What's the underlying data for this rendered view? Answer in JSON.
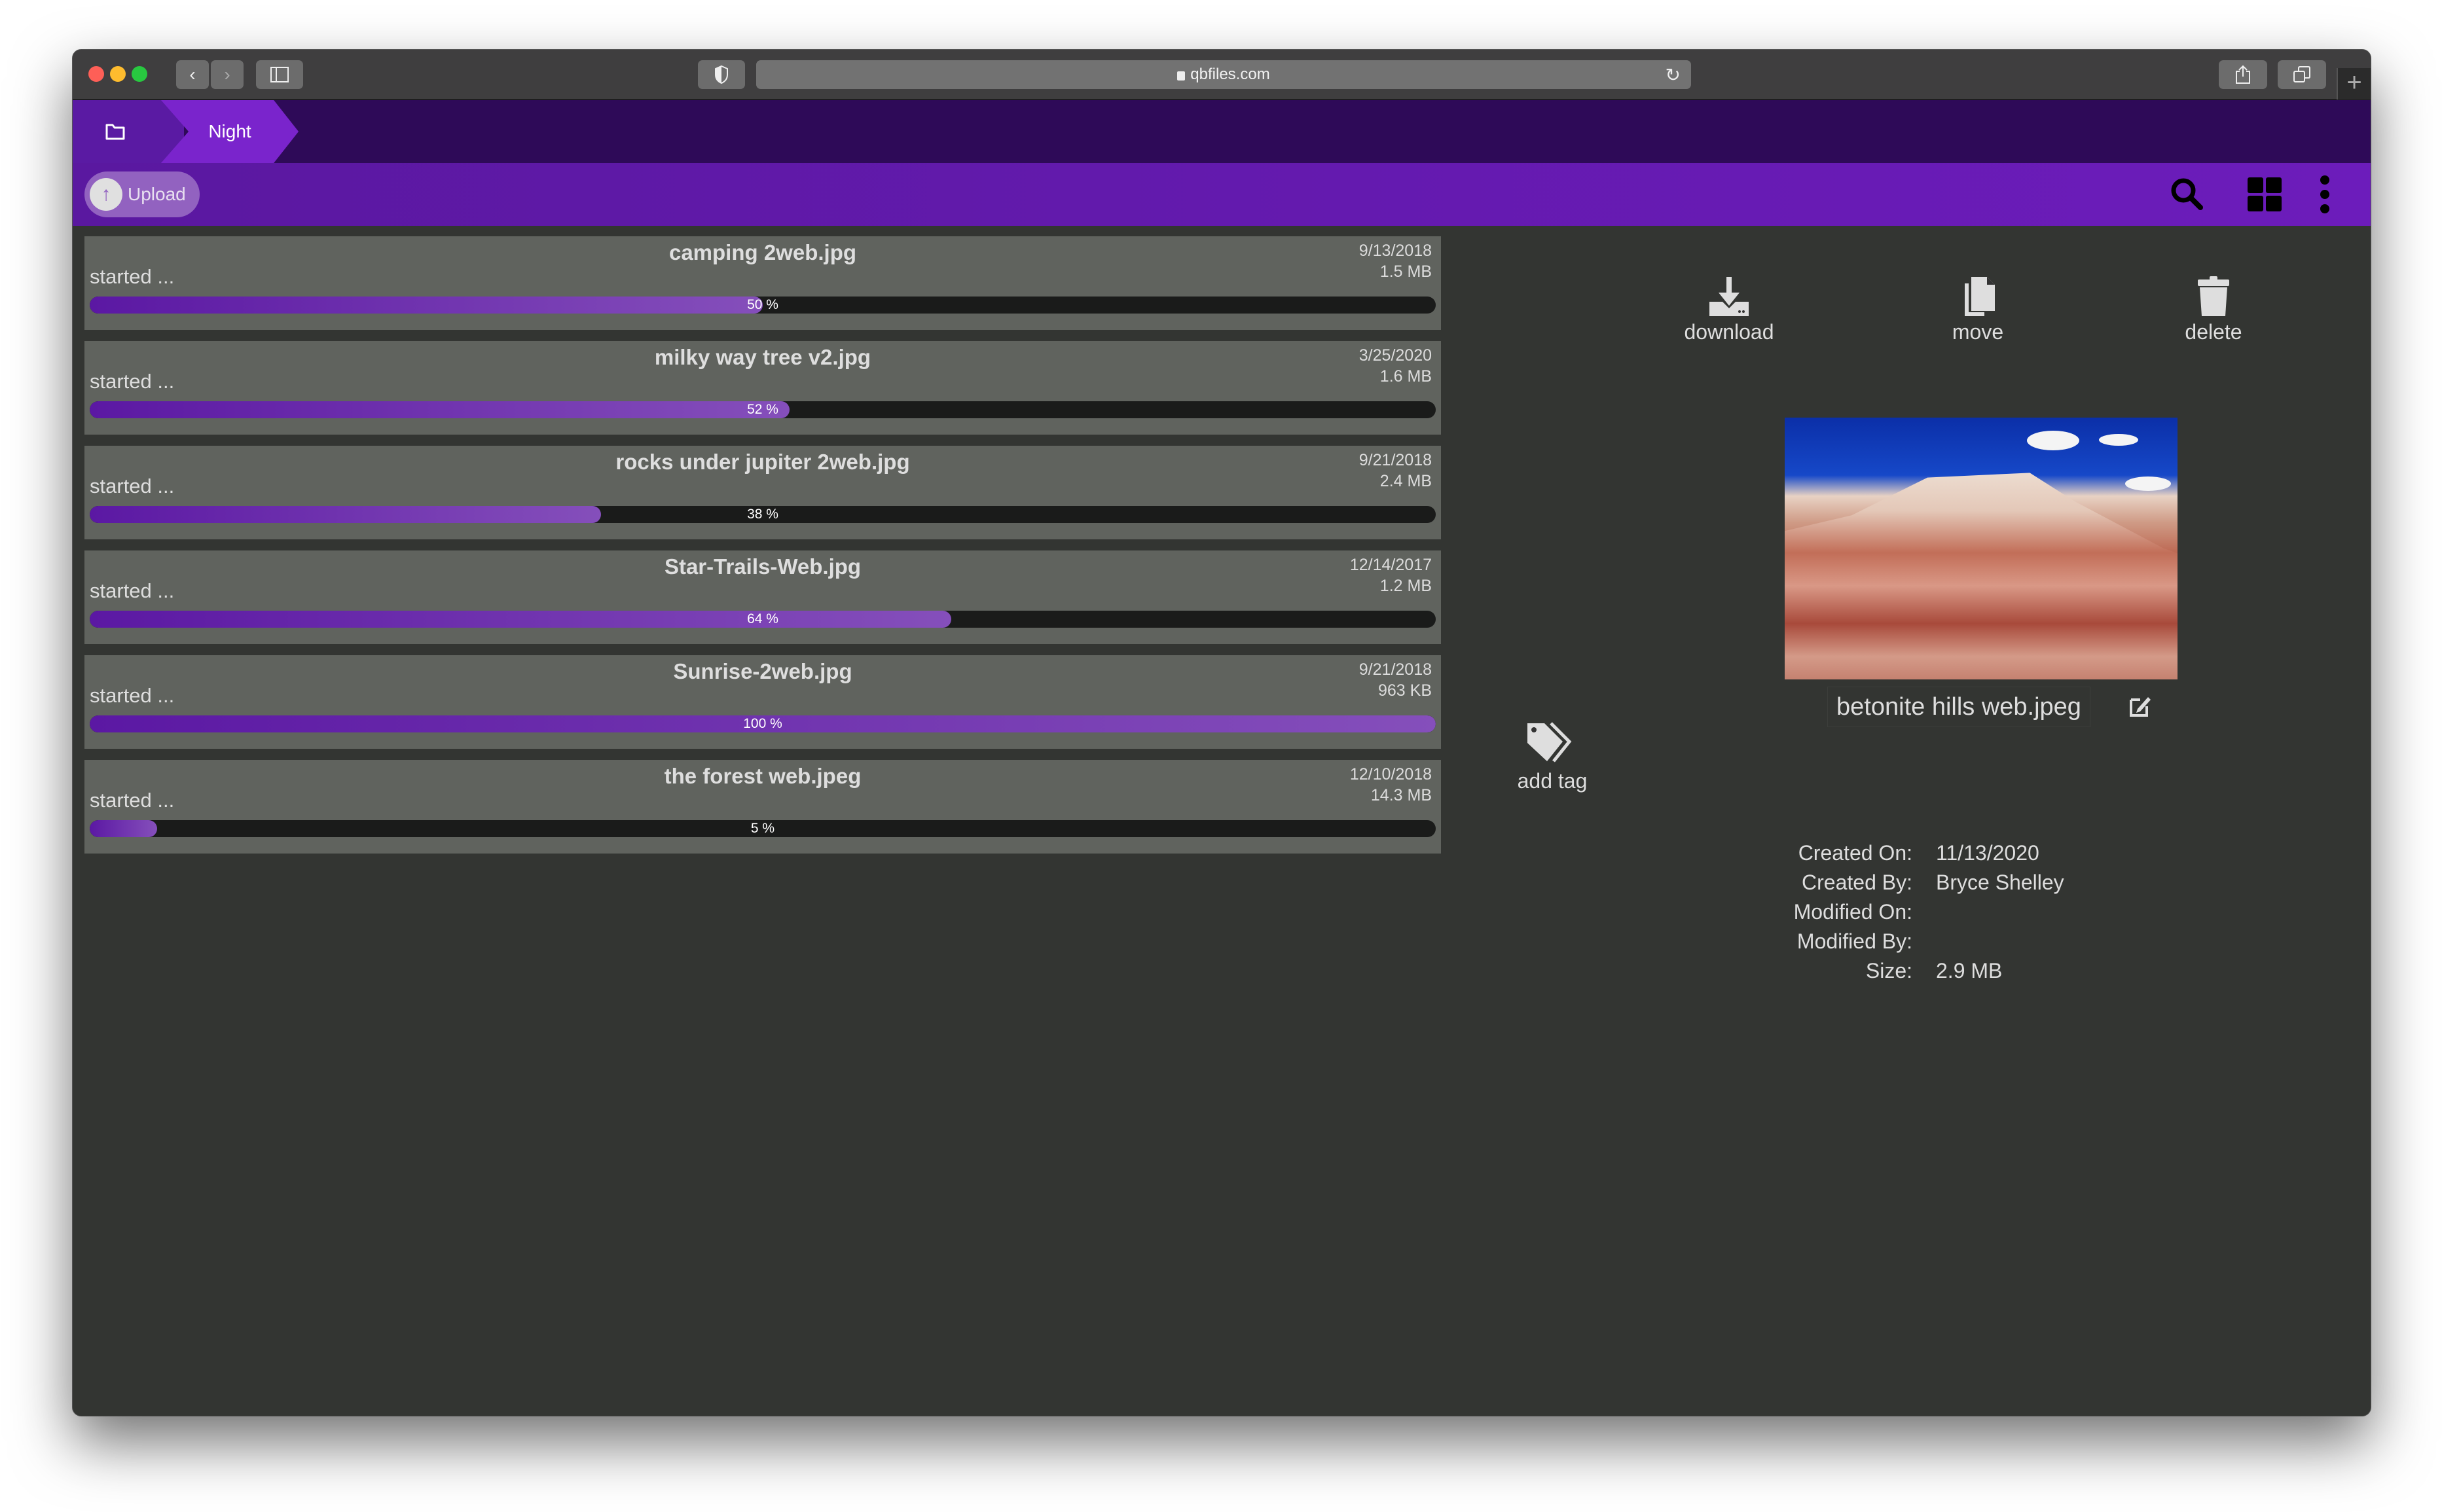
{
  "browser": {
    "url": "qbfiles.com",
    "buttons": [
      "back",
      "forward",
      "sidebar",
      "shield",
      "reload",
      "share",
      "tabs",
      "new-tab"
    ]
  },
  "breadcrumb": {
    "home_icon": "folder-icon",
    "items": [
      {
        "label": "Night"
      }
    ]
  },
  "toolbar": {
    "upload_label": "Upload",
    "icons": [
      "search-icon",
      "grid-view-icon",
      "more-vert-icon"
    ]
  },
  "uploads": [
    {
      "name": "camping 2web.jpg",
      "status": "started ...",
      "date": "9/13/2018",
      "size": "1.5 MB",
      "progress": 50,
      "progress_label": "50 %"
    },
    {
      "name": "milky way tree v2.jpg",
      "status": "started ...",
      "date": "3/25/2020",
      "size": "1.6 MB",
      "progress": 52,
      "progress_label": "52 %"
    },
    {
      "name": "rocks under jupiter 2web.jpg",
      "status": "started ...",
      "date": "9/21/2018",
      "size": "2.4 MB",
      "progress": 38,
      "progress_label": "38 %"
    },
    {
      "name": "Star-Trails-Web.jpg",
      "status": "started ...",
      "date": "12/14/2017",
      "size": "1.2 MB",
      "progress": 64,
      "progress_label": "64 %"
    },
    {
      "name": "Sunrise-2web.jpg",
      "status": "started ...",
      "date": "9/21/2018",
      "size": "963 KB",
      "progress": 100,
      "progress_label": "100 %"
    },
    {
      "name": "the forest web.jpeg",
      "status": "started ...",
      "date": "12/10/2018",
      "size": "14.3 MB",
      "progress": 5,
      "progress_label": "5 %"
    }
  ],
  "preview": {
    "actions": {
      "download": "download",
      "move": "move",
      "delete": "delete",
      "add_tag": "add tag"
    },
    "filename": "betonite hills web.jpeg",
    "details": [
      {
        "key": "Created On:",
        "value": "11/13/2020"
      },
      {
        "key": "Created By:",
        "value": "Bryce Shelley"
      },
      {
        "key": "Modified On:",
        "value": ""
      },
      {
        "key": "Modified By:",
        "value": ""
      },
      {
        "key": "Size:",
        "value": "2.9 MB"
      }
    ]
  },
  "colors": {
    "breadcrumb_bg": "#2e0a58",
    "breadcrumb_active": "#7a24cc",
    "toolbar_bg": "#6c1cbb",
    "progress_fill": "#854fbb",
    "row_bg": "#60635e",
    "page_bg": "#333532"
  }
}
